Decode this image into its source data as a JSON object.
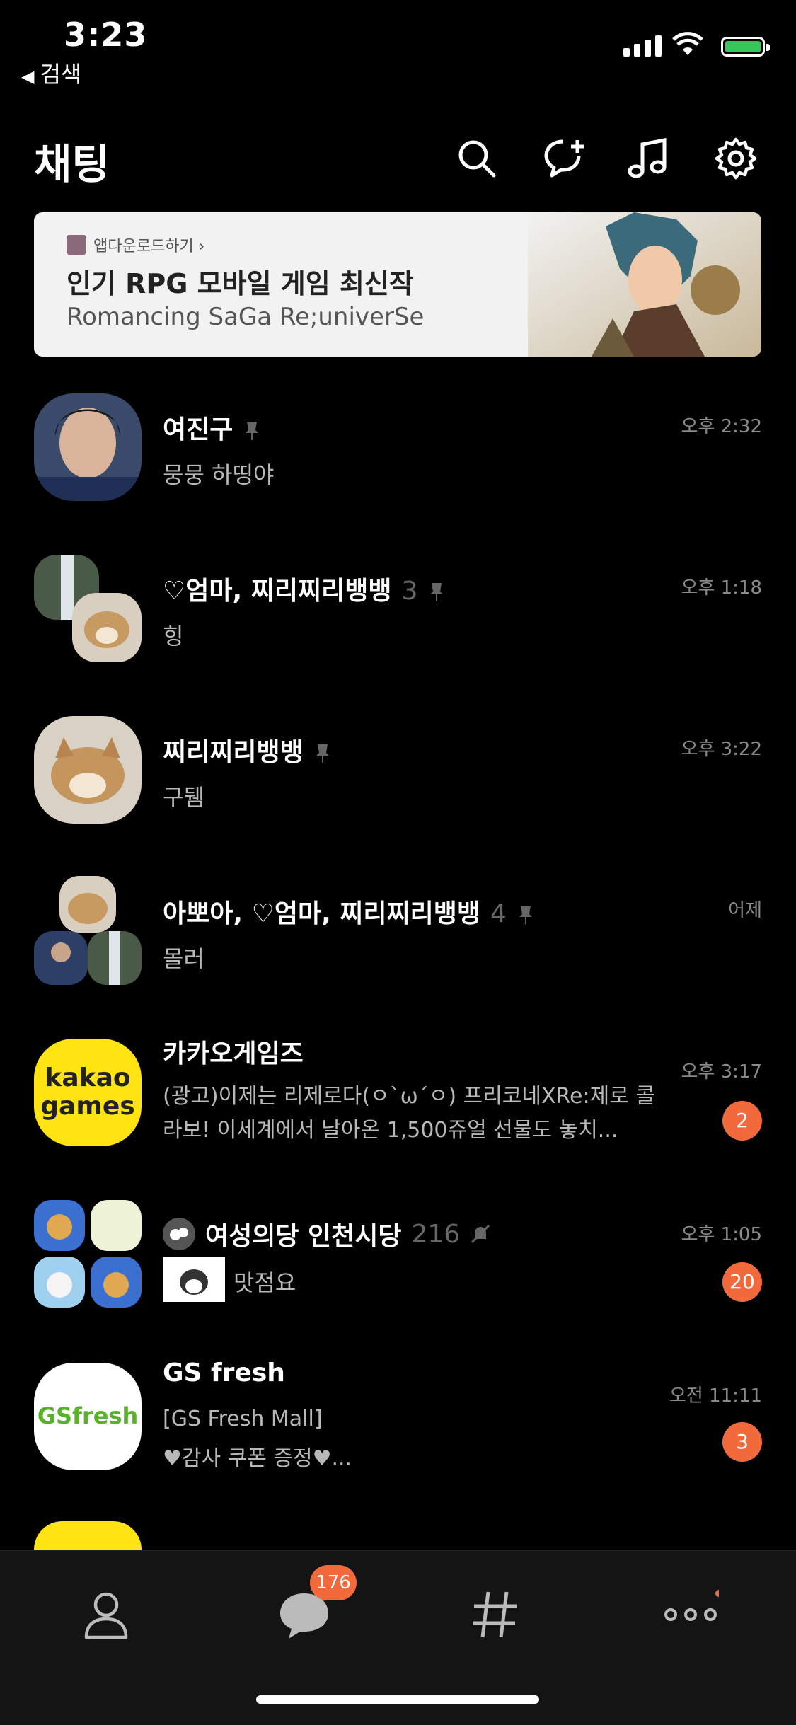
{
  "status": {
    "time": "3:23",
    "back_app": "검색"
  },
  "header": {
    "title": "채팅"
  },
  "ad": {
    "source": "앱다운로드하기 ›",
    "headline": "인기 RPG 모바일 게임 최신작",
    "subtitle": "Romancing SaGa Re;univerSe"
  },
  "chats": [
    {
      "name": "여진구",
      "count": "",
      "message": "뭉뭉 하띵야",
      "time": "오후 2:32",
      "badge": ""
    },
    {
      "name": "♡엄마, 찌리찌리뱅뱅",
      "count": "3",
      "message": "힝",
      "time": "오후 1:18",
      "badge": ""
    },
    {
      "name": "찌리찌리뱅뱅",
      "count": "",
      "message": "구뒘",
      "time": "오후 3:22",
      "badge": ""
    },
    {
      "name": "아뽀아, ♡엄마, 찌리찌리뱅뱅",
      "count": "4",
      "message": "몰러",
      "time": "어제",
      "badge": ""
    },
    {
      "name": "카카오게임즈",
      "count": "",
      "message": "(광고)이제는 리제로다(ㅇ`ω´ㅇ) 프리코네XRe:제로 콜라보! 이세계에서 날아온 1,500쥬얼 선물도 놓치...",
      "time": "오후 3:17",
      "badge": "2"
    },
    {
      "name": "여성의당 인천시당",
      "count": "216",
      "message": "맛점요",
      "time": "오후 1:05",
      "badge": "20"
    },
    {
      "name": "GS fresh",
      "count": "",
      "message_line1": "[GS Fresh Mall]",
      "message_line2": "♥감사 쿠폰 증정♥...",
      "time": "오전 11:11",
      "badge": "3"
    }
  ],
  "avatars": {
    "kakao_line1": "kakao",
    "kakao_line2": "games",
    "gs_logo": "GSfresh"
  },
  "tabs": {
    "chat_badge": "176"
  },
  "colors": {
    "accent_badge": "#f26a3c",
    "background": "#000000",
    "ad_background": "#f2f2f2"
  }
}
